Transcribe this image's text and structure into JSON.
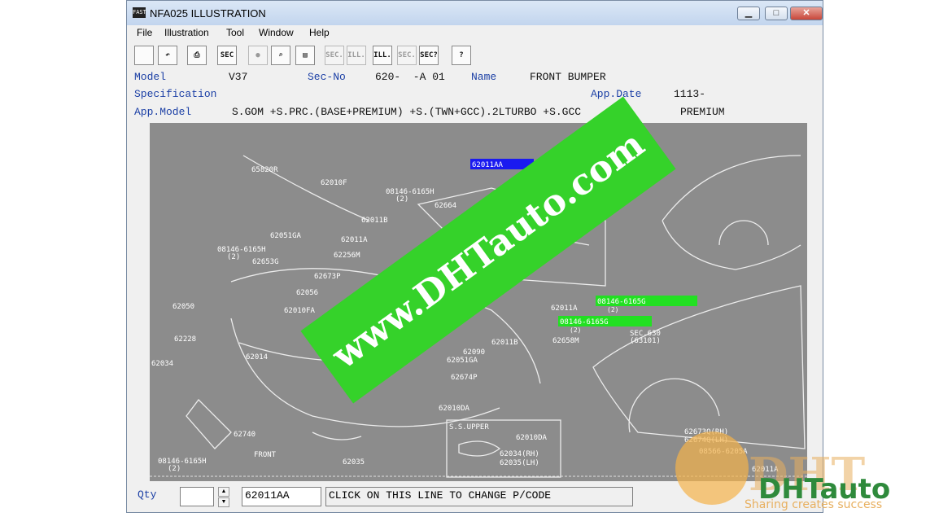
{
  "window": {
    "title": "NFA025 ILLUSTRATION",
    "icon_text": "FAST",
    "controls": [
      "minimize-icon",
      "maximize-icon",
      "close-icon"
    ]
  },
  "menu": [
    "File",
    "Illustration",
    "Tool",
    "Window",
    "Help"
  ],
  "toolbar": {
    "buttons": [
      {
        "name": "car-parts-icon",
        "label": ""
      },
      {
        "name": "undo-icon",
        "label": "↶"
      },
      {
        "name": "print-icon",
        "label": "⎙"
      },
      {
        "name": "sec-icon",
        "label": "SEC"
      },
      {
        "name": "circle-icon",
        "label": "●"
      },
      {
        "name": "magnifier-icon",
        "label": "⌕"
      },
      {
        "name": "book-icon",
        "label": "▤"
      },
      {
        "name": "prev-sec-icon",
        "label": "SEC."
      },
      {
        "name": "prev-ill-icon",
        "label": "ILL."
      },
      {
        "name": "next-ill-icon",
        "label": "ILL."
      },
      {
        "name": "next-sec-icon",
        "label": "SEC."
      },
      {
        "name": "sec-query-icon",
        "label": "SEC?"
      },
      {
        "name": "help-icon",
        "label": "?"
      }
    ]
  },
  "info": {
    "model_label": "Model",
    "model_value": "V37",
    "secno_label": "Sec-No",
    "secno_value": "620-  -A 01",
    "name_label": "Name",
    "name_value": "FRONT BUMPER",
    "spec_label": "Specification",
    "appdate_label": "App.Date",
    "appdate_value": "1113-",
    "appmodel_label": "App.Model",
    "appmodel_value": "S.GOM +S.PRC.(BASE+PREMIUM) +S.(TWN+GCC).2LTURBO +S.GCC",
    "appmodel_tail": "PREMIUM"
  },
  "diagram": {
    "labels": {
      "l1": "65820R",
      "l2": "62010F",
      "l3": "08146-6165H",
      "l3q": "(2)",
      "l4": "62664",
      "l5": "62011B",
      "l6": "62011A",
      "l7": "62051GA",
      "l8": "08146-6165H",
      "l8q": "(2)",
      "l9": "62653G",
      "l10": "62256M",
      "l11": "62673P",
      "l12": "62056",
      "l13": "62050",
      "l14": "62010FA",
      "l15": "62228",
      "l16": "62034",
      "l17": "62014",
      "l18": "62090",
      "l19": "62011B",
      "l20": "62658M",
      "l21": "62051GA",
      "l22": "62674P",
      "l23": "62010DA",
      "l24": "62740",
      "l25": "08146-6165H",
      "l25q": "(2)",
      "l26": "FRONT",
      "l27": "62035",
      "l28": "S.S.UPPER",
      "l29": "62010DA",
      "l30": "62034(RH)",
      "l31": "62035(LH)",
      "l32": "62011A",
      "l33": "SEC.630",
      "l34": "(63101)",
      "l35": "62673Q(RH)",
      "l36": "62674Q(LH)",
      "l37": "08566-6205A",
      "l38": "62011A",
      "hl1": "62011AA",
      "hl2": "08146-6165G",
      "hl2q": "(2)",
      "hl3": "08146-6165G",
      "hl3q": "(2)"
    }
  },
  "bottom": {
    "qty_label": "Qty",
    "qty_value": "",
    "part_code": "62011AA",
    "message": "CLICK ON THIS LINE TO CHANGE P/CODE"
  },
  "overlay": {
    "watermark_text": "www.DHTauto.com",
    "logo_text": "DHTauto",
    "logo_slogan": "Sharing creates success"
  },
  "colors": {
    "highlight_blue": "#1a1af0",
    "highlight_green": "#22e022",
    "canvas_bg": "#8c8c8c",
    "info_blue": "#1b3fa5",
    "watermark_green": "#35d22a"
  }
}
